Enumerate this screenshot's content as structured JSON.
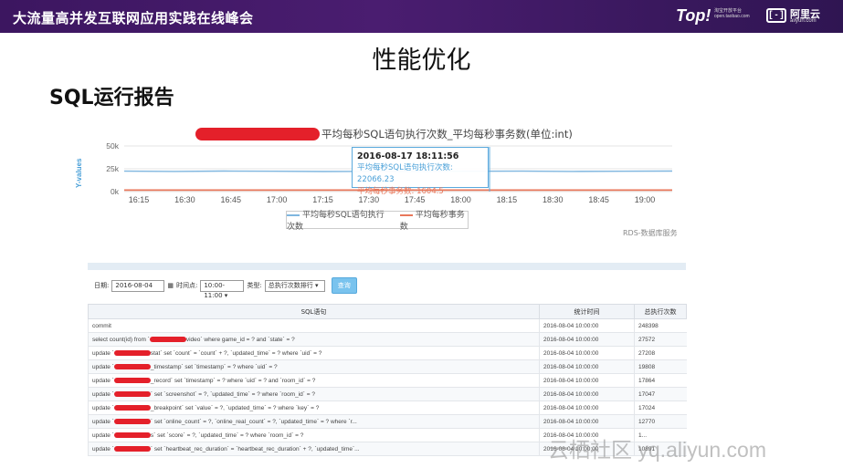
{
  "banner": {
    "title": "大流量高并发互联网应用实践在线峰会",
    "logo_top": "Top!",
    "logo_top_sub": "淘宝开放平台 open.taobao.com",
    "logo_ali_text": "阿里云",
    "logo_ali_sub": "aliyun.com",
    "logo_ali_box": "[ - ]"
  },
  "page_title": "性能优化",
  "section_title": "SQL运行报告",
  "chart_data": {
    "type": "line",
    "title": "平均每秒SQL语句执行次数_平均每秒事务数(单位:int)",
    "ylabel": "Y-values",
    "y_ticks": [
      "50k",
      "25k",
      "0k"
    ],
    "ylim": [
      0,
      50000
    ],
    "x_ticks": [
      "16:15",
      "16:30",
      "16:45",
      "17:00",
      "17:15",
      "17:30",
      "17:45",
      "18:00",
      "18:15",
      "18:30",
      "18:45",
      "19:00"
    ],
    "series": [
      {
        "name": "平均每秒SQL语句执行次数",
        "color": "#7fb6df",
        "values": [
          22400,
          22100,
          22500,
          22300,
          22000,
          22200,
          22066,
          22300,
          22400,
          22100,
          22300,
          22500
        ]
      },
      {
        "name": "平均每秒事务数",
        "color": "#e8775a",
        "values": [
          1600,
          1605,
          1598,
          1602,
          1600,
          1603,
          1604,
          1601,
          1599,
          1602,
          1604,
          1600
        ]
      }
    ],
    "tooltip": {
      "time": "2016-08-17 18:11:56",
      "s1_label": "平均每秒SQL语句执行次数",
      "s1_value": "22066.23",
      "s2_label": "平均每秒事务数",
      "s2_value": "1604.5"
    },
    "legend_position": "bottom",
    "grid": true,
    "source": "RDS-数据库服务"
  },
  "filters": {
    "date_label": "日期:",
    "date_value": "2016-08-04",
    "time_label": "时间点:",
    "time_value": "10:00-11:00",
    "type_label": "类型:",
    "type_value": "总执行次数排行",
    "query_label": "查询"
  },
  "table": {
    "headers": [
      "SQL语句",
      "统计时间",
      "总执行次数"
    ],
    "rows": [
      {
        "pre": "commit",
        "red": false,
        "post": "",
        "time": "2016-08-04 10:00:00",
        "count": "248398"
      },
      {
        "pre": "select count(id) from `",
        "red": true,
        "post": "video` where game_id = ? and `state` = ?",
        "time": "2016-08-04 10:00:00",
        "count": "27572"
      },
      {
        "pre": "update `",
        "red": true,
        "post": "stat` set `count` = `count` + ?, `updated_time` = ? where `uid` = ?",
        "time": "2016-08-04 10:00:00",
        "count": "27208"
      },
      {
        "pre": "update `",
        "red": true,
        "post": "_timestamp` set `timestamp` = ? where `uid` = ?",
        "time": "2016-08-04 10:00:00",
        "count": "19808"
      },
      {
        "pre": "update `",
        "red": true,
        "post": "_record` set `timestamp` = ? where `uid` = ? and `room_id` = ?",
        "time": "2016-08-04 10:00:00",
        "count": "17864"
      },
      {
        "pre": "update `",
        "red": true,
        "post": "` set `screenshot` = ?, `updated_time` = ? where `room_id` = ?",
        "time": "2016-08-04 10:00:00",
        "count": "17047"
      },
      {
        "pre": "update `",
        "red": true,
        "post": "_breakpoint` set `value` = ?, `updated_time` = ? where `key` = ?",
        "time": "2016-08-04 10:00:00",
        "count": "17024"
      },
      {
        "pre": "update `",
        "red": true,
        "post": "` set `online_count` = ?, `online_real_count` = ?, `updated_time` = ? where `r...",
        "time": "2016-08-04 10:00:00",
        "count": "12770"
      },
      {
        "pre": "update `",
        "red": true,
        "post": "s` set `score` = ?, `updated_time` = ? where `room_id` = ?",
        "time": "2016-08-04 10:00:00",
        "count": "1..."
      },
      {
        "pre": "update `",
        "red": true,
        "post": "` set `heartbeat_rec_duration` = `heartbeat_rec_duration` + ?, `updated_time`...",
        "time": "2016-08-04 10:00:00",
        "count": "10891"
      }
    ]
  },
  "watermark": "云栖社区 yq.aliyun.com",
  "colors": {
    "banner": "#3c1660",
    "accent_blue": "#4aa0d8",
    "accent_orange": "#e8775a",
    "redaction": "#e4202a"
  }
}
